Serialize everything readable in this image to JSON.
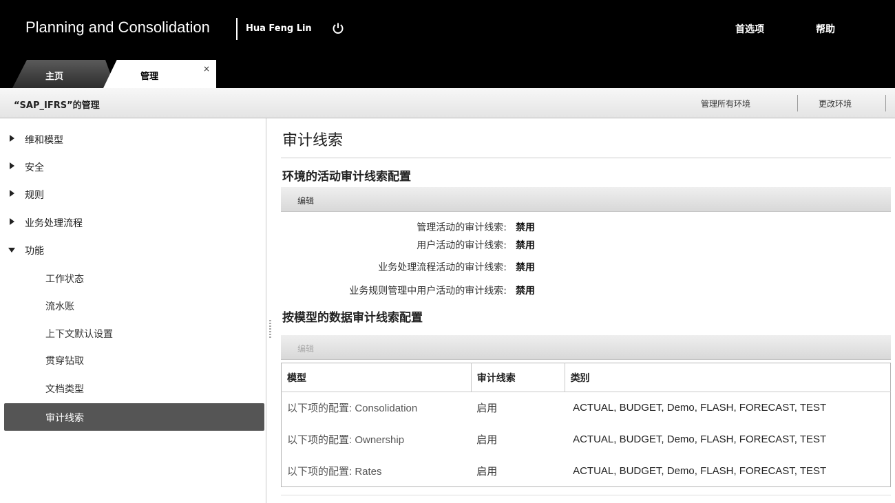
{
  "header": {
    "app_title": "Planning and Consolidation",
    "user_name": "Hua Feng Lin",
    "preferences": "首选项",
    "help": "帮助"
  },
  "tabs": [
    {
      "label": "主页"
    },
    {
      "label": "管理"
    }
  ],
  "tab_close_glyph": "×",
  "subheader": {
    "title": "“SAP_IFRS”的管理",
    "manage_all": "管理所有环境",
    "change_env": "更改环境"
  },
  "sidebar": {
    "items": [
      {
        "label": "维和模型"
      },
      {
        "label": "安全"
      },
      {
        "label": "规则"
      },
      {
        "label": "业务处理流程"
      },
      {
        "label": "功能"
      }
    ],
    "sub_items": [
      {
        "label": "工作状态"
      },
      {
        "label": "流水账"
      },
      {
        "label": "上下文默认设置"
      },
      {
        "label": "贯穿钻取"
      },
      {
        "label": "文档类型"
      },
      {
        "label": "审计线索"
      }
    ]
  },
  "main": {
    "title": "审计线索",
    "section1_title": "环境的活动审计线索配置",
    "edit_label": "编辑",
    "settings": [
      {
        "label": "管理活动的审计线索:",
        "value": "禁用"
      },
      {
        "label": "用户活动的审计线索:",
        "value": "禁用"
      },
      {
        "label": "业务处理流程活动的审计线索:",
        "value": "禁用"
      },
      {
        "label": "业务规则管理中用户活动的审计线索:",
        "value": "禁用"
      }
    ],
    "section2_title": "按模型的数据审计线索配置",
    "edit2_label": "编辑",
    "table": {
      "headers": [
        "模型",
        "审计线索",
        "类别"
      ],
      "rows": [
        {
          "model": "以下项的配置:  Consolidation",
          "audit": "启用",
          "categories": "ACTUAL, BUDGET, Demo, FLASH, FORECAST, TEST"
        },
        {
          "model": "以下项的配置:  Ownership",
          "audit": "启用",
          "categories": "ACTUAL, BUDGET, Demo, FLASH, FORECAST, TEST"
        },
        {
          "model": "以下项的配置:  Rates",
          "audit": "启用",
          "categories": "ACTUAL, BUDGET, Demo, FLASH, FORECAST, TEST"
        }
      ]
    }
  },
  "icons": {
    "power": "power-icon",
    "expand": "triangle-right-icon",
    "collapse": "triangle-down-icon"
  }
}
